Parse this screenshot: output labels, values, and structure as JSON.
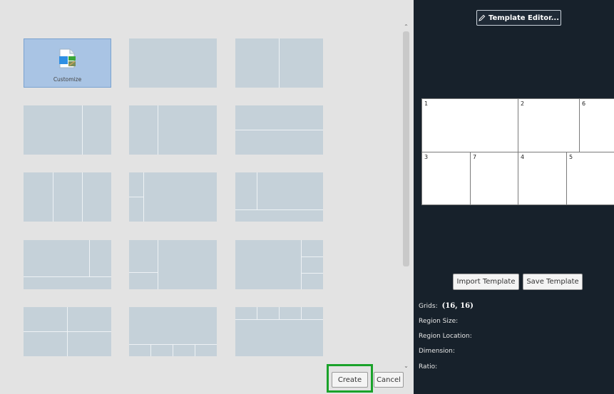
{
  "left": {
    "customize_label": "Customize",
    "create_label": "Create",
    "cancel_label": "Cancel"
  },
  "right": {
    "template_editor_label": "Template Editor...",
    "import_label": "Import Template",
    "save_label": "Save Template",
    "preview_cells": [
      "1",
      "2",
      "6",
      "3",
      "7",
      "4",
      "5"
    ],
    "info": {
      "grids_label": "Grids:",
      "grids_value": "(16, 16)",
      "region_size_label": "Region Size:",
      "region_location_label": "Region Location:",
      "dimension_label": "Dimension:",
      "ratio_label": "Ratio:"
    }
  },
  "icons": {
    "scroll_up": "chevron-up-icon",
    "scroll_down": "chevron-down-icon",
    "customize": "document-layout-icon",
    "pencil": "pencil-icon"
  },
  "colors": {
    "highlight": "#1aa22a",
    "tile": "#c5d1d9",
    "selected_tile": "#a9c4e4",
    "dark_panel": "#17212b"
  }
}
